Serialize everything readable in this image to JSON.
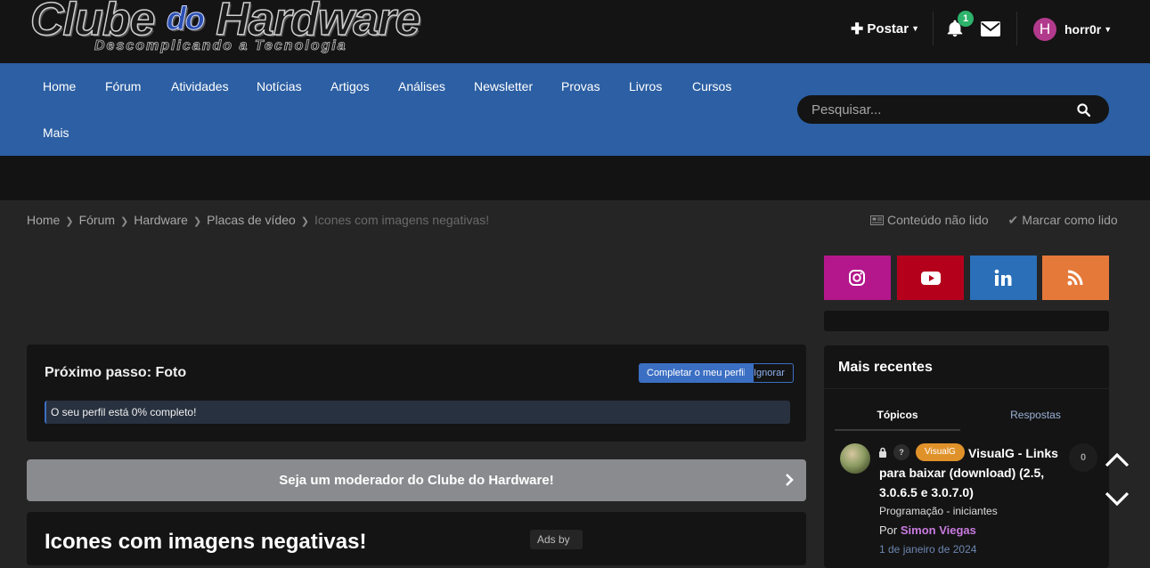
{
  "header": {
    "logo_main": "Clube",
    "logo_do": "do",
    "logo_main2": "Hardware",
    "logo_sub": "Descomplicando a Tecnologia",
    "postar_label": "Postar",
    "notification_count": "1",
    "avatar_letter": "H",
    "username": "horr0r"
  },
  "nav": {
    "items": [
      "Home",
      "Fórum",
      "Atividades",
      "Notícias",
      "Artigos",
      "Análises",
      "Newsletter",
      "Provas",
      "Livros",
      "Cursos"
    ],
    "more": "Mais",
    "search_placeholder": "Pesquisar..."
  },
  "breadcrumb": {
    "items": [
      "Home",
      "Fórum",
      "Hardware",
      "Placas de vídeo"
    ],
    "current": "Icones com imagens negativas!",
    "unread": "Conteúdo não lido",
    "mark_read": "Marcar como lido"
  },
  "social": {
    "colors": {
      "instagram": "#b3178b",
      "youtube": "#b5001c",
      "linkedin": "#2a6fb8",
      "rss": "#e5793a"
    }
  },
  "profile_step": {
    "title": "Próximo passo: Foto",
    "complete_button": "Completar o meu perfil",
    "ignore_button": "Ignorar",
    "progress_text": "O seu perfil está 0% completo!",
    "progress_percent": 0
  },
  "moderator_banner": "Seja um moderador do Clube do Hardware!",
  "topic": {
    "title": "Icones com imagens negativas!",
    "ads_label": "Ads by"
  },
  "recent": {
    "title": "Mais recentes",
    "tab_topics": "Tópicos",
    "tab_replies": "Respostas",
    "item": {
      "tag": "VisualG",
      "title": "VisualG - Links para baixar (download) (2.5, 3.0.6.5 e 3.0.7.0)",
      "forum": "Programação - iniciantes",
      "by_prefix": "Por",
      "author": "Simon Viegas",
      "date": "1 de janeiro de 2024",
      "replies": "0",
      "qmark": "?"
    }
  }
}
